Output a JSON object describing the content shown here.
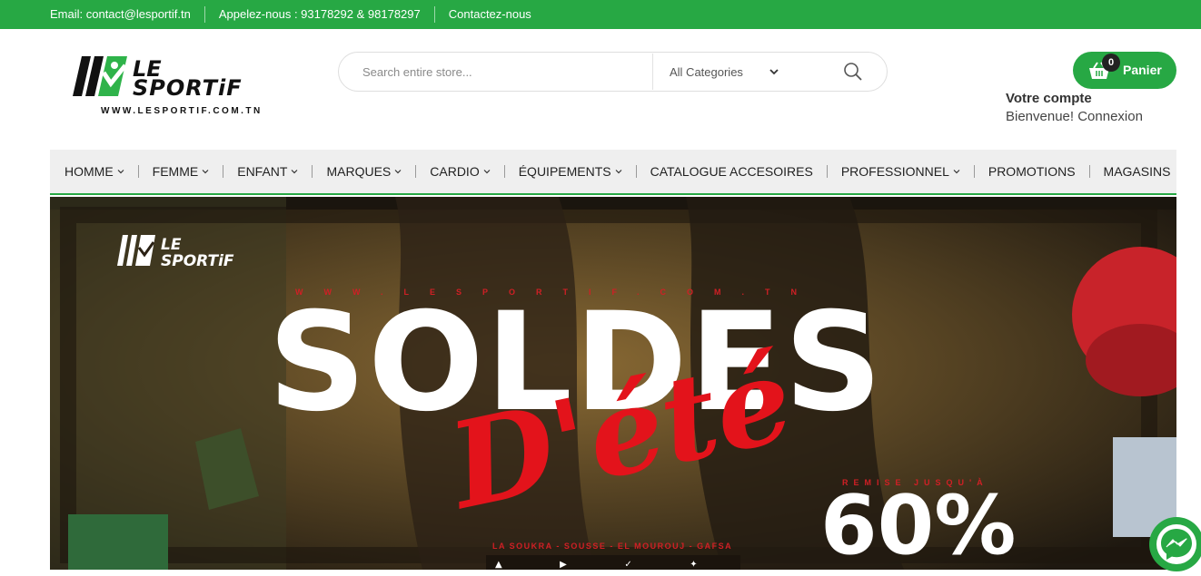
{
  "topbar": {
    "email": "Email: contact@lesportif.tn",
    "phone": "Appelez-nous : 93178292 & 98178297",
    "contact": "Contactez-nous"
  },
  "header": {
    "logo_tagline": "WWW.LESPORTIF.COM.TN",
    "search": {
      "placeholder": "Search entire store...",
      "value": "",
      "category_selected": "All Categories"
    },
    "cart": {
      "count": "0",
      "label": "Panier"
    },
    "account": {
      "title": "Votre compte",
      "subtitle": "Bienvenue! Connexion"
    }
  },
  "nav": {
    "items": [
      {
        "label": "HOMME",
        "has_dropdown": true
      },
      {
        "label": "FEMME",
        "has_dropdown": true
      },
      {
        "label": "ENFANT",
        "has_dropdown": true
      },
      {
        "label": "MARQUES",
        "has_dropdown": true
      },
      {
        "label": "CARDIO",
        "has_dropdown": true
      },
      {
        "label": "ÉQUIPEMENTS",
        "has_dropdown": true
      },
      {
        "label": "CATALOGUE ACCESOIRES",
        "has_dropdown": false
      },
      {
        "label": "PROFESSIONNEL",
        "has_dropdown": true
      },
      {
        "label": "PROMOTIONS",
        "has_dropdown": false
      },
      {
        "label": "MAGASINS",
        "has_dropdown": false
      }
    ]
  },
  "banner": {
    "url_text": "WWW.LESPORTIF.COM.TN",
    "headline": "SOLDES",
    "script": "D'été",
    "remise": "REMISE JUSQU'À",
    "percent": "60%",
    "stores": "LA SOUKRA - SOUSSE - EL MOUROUJ - GAFSA"
  },
  "colors": {
    "brand_green": "#27a844",
    "accent_red": "#e3131b",
    "nav_bg": "#efefef"
  },
  "icons": {
    "search": "search-icon",
    "chevron": "chevron-down-icon",
    "cart": "basket-icon",
    "messenger": "messenger-icon"
  }
}
